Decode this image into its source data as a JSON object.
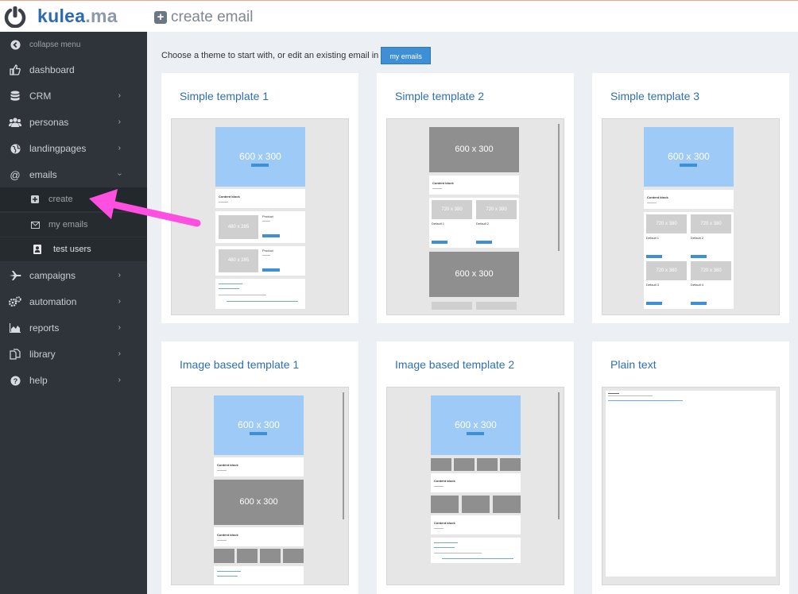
{
  "app": {
    "logo_text": "kulea",
    "logo_tld": ".ma",
    "page_title": "create email"
  },
  "sidebar": {
    "collapse": "collapse menu",
    "items": [
      {
        "label": "dashboard",
        "icon": "thumbs-up-icon"
      },
      {
        "label": "CRM",
        "icon": "database-icon"
      },
      {
        "label": "personas",
        "icon": "users-icon"
      },
      {
        "label": "landingpages",
        "icon": "globe-icon"
      },
      {
        "label": "emails",
        "icon": "at-icon"
      },
      {
        "label": "campaigns",
        "icon": "plane-icon"
      },
      {
        "label": "automation",
        "icon": "cogs-icon"
      },
      {
        "label": "reports",
        "icon": "area-chart-icon"
      },
      {
        "label": "library",
        "icon": "files-icon"
      },
      {
        "label": "help",
        "icon": "question-icon"
      }
    ],
    "email_sub": [
      {
        "label": "create",
        "icon": "plus-square-icon"
      },
      {
        "label": "my emails",
        "icon": "envelope-icon"
      },
      {
        "label": "test users",
        "icon": "user-icon"
      }
    ]
  },
  "main": {
    "intro": "Choose a theme to start with, or edit an existing email in",
    "my_emails_button": "my emails",
    "templates": [
      {
        "title": "Simple template 1"
      },
      {
        "title": "Simple template 2"
      },
      {
        "title": "Simple template 3"
      },
      {
        "title": "Image based template 1"
      },
      {
        "title": "Image based template 2"
      },
      {
        "title": "Plain text"
      }
    ],
    "thumb_text": {
      "size_600": "600 x 300",
      "size_480": "480 x 285",
      "size_720": "720 x 380",
      "content_block": "Content block",
      "product": "Product",
      "default1": "Default 1",
      "default2": "Default 2",
      "default3": "Default 3",
      "default4": "Default 4"
    }
  },
  "colors": {
    "accent": "#3f8fd6",
    "sidebar": "#2e343a",
    "arrow": "#ff4fe0"
  }
}
